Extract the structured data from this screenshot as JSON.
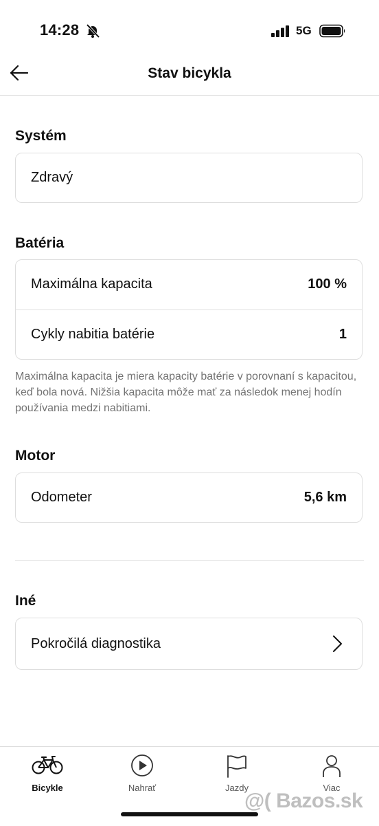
{
  "status_bar": {
    "time": "14:28",
    "network": "5G"
  },
  "header": {
    "title": "Stav bicykla"
  },
  "system": {
    "title": "Systém",
    "status": "Zdravý"
  },
  "battery": {
    "title": "Batéria",
    "rows": [
      {
        "label": "Maximálna kapacita",
        "value": "100 %"
      },
      {
        "label": "Cykly nabitia batérie",
        "value": "1"
      }
    ],
    "note": "Maximálna kapacita je miera kapacity batérie v porovnaní s kapacitou, keď bola nová. Nižšia kapacita môže mať za následok menej hodín používania medzi nabitiami."
  },
  "motor": {
    "title": "Motor",
    "rows": [
      {
        "label": "Odometer",
        "value": "5,6 km"
      }
    ]
  },
  "other": {
    "title": "Iné",
    "rows": [
      {
        "label": "Pokročilá diagnostika"
      }
    ]
  },
  "tabs": [
    {
      "label": "Bicykle",
      "icon": "bicycle-icon",
      "active": true
    },
    {
      "label": "Nahrať",
      "icon": "play-icon",
      "active": false
    },
    {
      "label": "Jazdy",
      "icon": "flag-icon",
      "active": false
    },
    {
      "label": "Viac",
      "icon": "person-icon",
      "active": false
    }
  ],
  "watermark": "@( Bazos.sk"
}
